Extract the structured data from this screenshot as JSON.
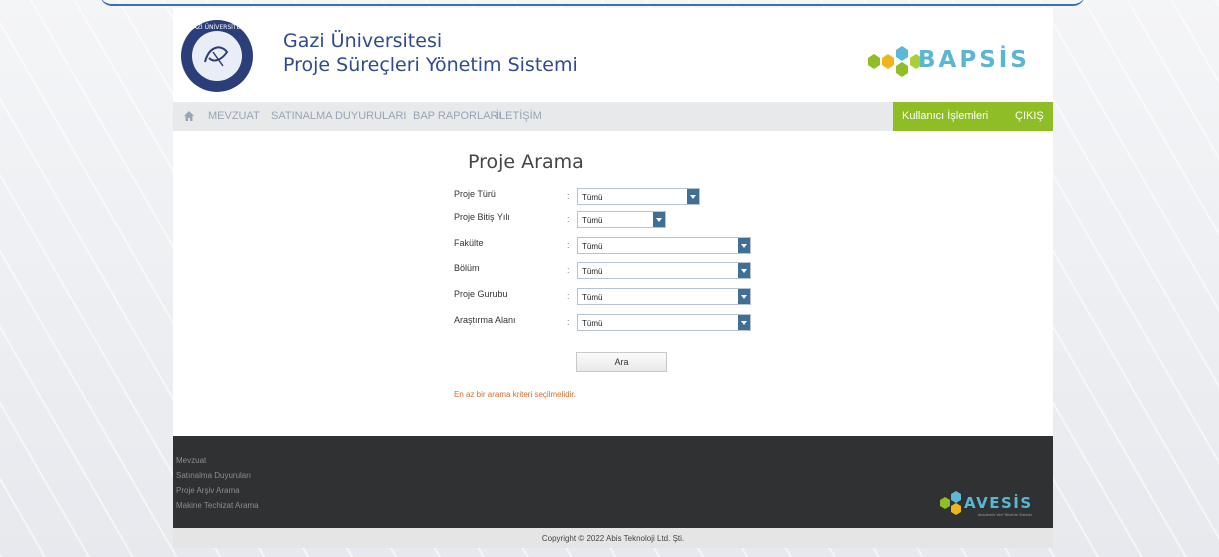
{
  "header": {
    "university": "Gazi Üniversitesi",
    "system_name": "Proje Süreçleri Yönetim Sistemi",
    "brand_logo_text": "BAPSİS",
    "seal_text": "GAZİ ÜNİVERSİTESİ",
    "seal_year": "1926"
  },
  "nav": {
    "items": [
      "MEVZUAT",
      "SATINALMA DUYURULARI",
      "BAP RAPORLARI",
      "İLETİŞİM"
    ],
    "user_menu": "Kullanıcı İşlemleri",
    "logout": "ÇIKIŞ"
  },
  "form": {
    "title": "Proje Arama",
    "fields": [
      {
        "label": "Proje Türü",
        "value": "Tümü"
      },
      {
        "label": "Proje Bitiş Yılı",
        "value": "Tümü"
      },
      {
        "label": "Fakülte",
        "value": "Tümü"
      },
      {
        "label": "Bölüm",
        "value": "Tümü"
      },
      {
        "label": "Proje Gurubu",
        "value": "Tümü"
      },
      {
        "label": "Araştırma Alanı",
        "value": "Tümü"
      }
    ],
    "colon": ":",
    "search_button": "Ara",
    "warning": "En az bir arama kriteri seçilmelidir."
  },
  "footer": {
    "links": [
      "Mevzuat",
      "Satınalma Duyuruları",
      "Proje Arşiv Arama",
      "Makine Techizat Arama"
    ],
    "avesis_logo_text": "AVESİS",
    "avesis_tagline": "Akademik Veri Yönetim Sistemi",
    "copyright": "Copyright © 2022 Abis Teknoloji Ltd. Şti."
  },
  "colors": {
    "accent_green": "#8ebd25",
    "title_blue": "#2f4a8f",
    "select_arrow": "#3f6f94",
    "warning": "#e06a2a",
    "footer_bg": "#2f3133"
  }
}
